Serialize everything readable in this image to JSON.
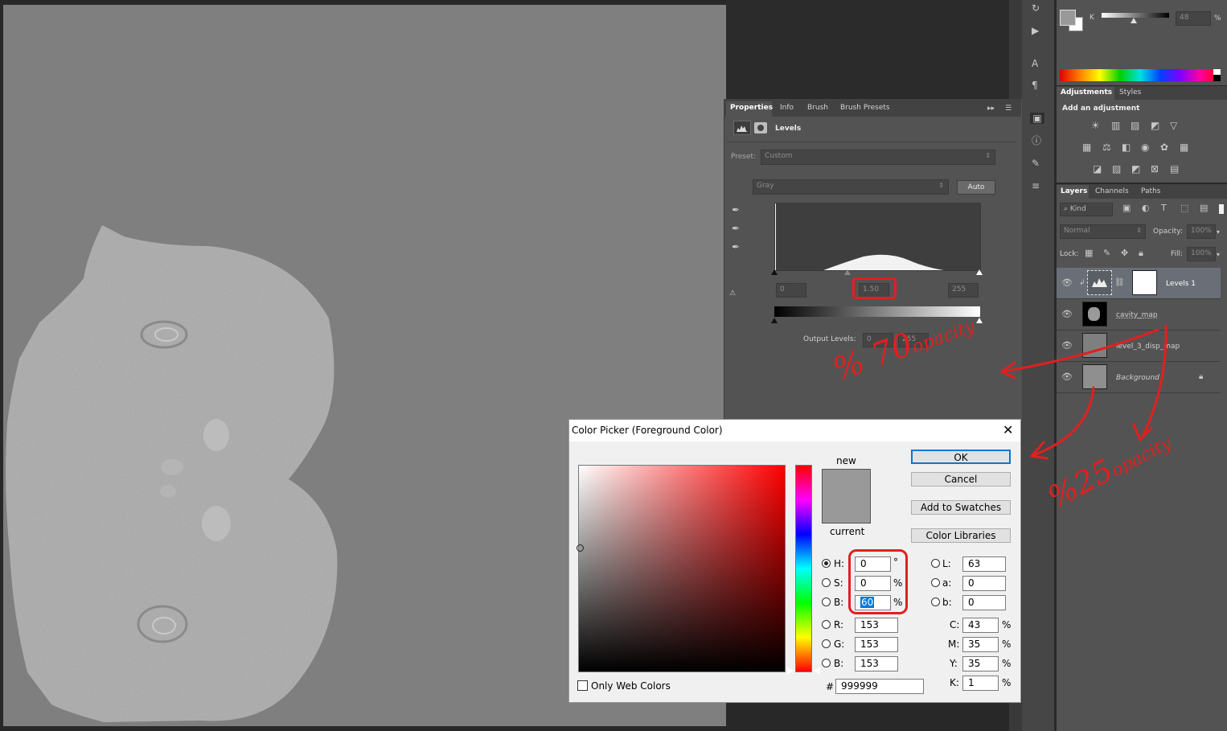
{
  "properties_panel": {
    "tabs": [
      "Properties",
      "Info",
      "Brush",
      "Brush Presets"
    ],
    "title": "Levels",
    "preset_label": "Preset:",
    "preset_value": "Custom",
    "channel_value": "Gray",
    "auto_label": "Auto",
    "input_black": "0",
    "input_gamma": "1.50",
    "input_white": "255",
    "output_label": "Output Levels:",
    "output_black": "0",
    "output_white": "255"
  },
  "color_panel": {
    "k_label": "K",
    "k_value": "48",
    "k_unit": "%"
  },
  "adjustments_panel": {
    "tabs": [
      "Adjustments",
      "Styles"
    ],
    "heading": "Add an adjustment"
  },
  "layers_panel": {
    "tabs": [
      "Layers",
      "Channels",
      "Paths"
    ],
    "filter_kind": "Kind",
    "blend_mode": "Normal",
    "opacity_label": "Opacity:",
    "opacity_value": "100%",
    "lock_label": "Lock:",
    "fill_label": "Fill:",
    "fill_value": "100%",
    "layers": [
      {
        "name": "Levels 1"
      },
      {
        "name": "cavity_map"
      },
      {
        "name": "level_3_disp_map"
      },
      {
        "name": "Background"
      }
    ]
  },
  "color_picker": {
    "title": "Color Picker (Foreground Color)",
    "new_label": "new",
    "current_label": "current",
    "ok_label": "OK",
    "cancel_label": "Cancel",
    "add_swatches_label": "Add to Swatches",
    "color_libraries_label": "Color Libraries",
    "h_label": "H:",
    "h_value": "0",
    "h_unit": "°",
    "s_label": "S:",
    "s_value": "0",
    "s_unit": "%",
    "b_label": "B:",
    "b_value": "60",
    "b_unit": "%",
    "r_label": "R:",
    "r_value": "153",
    "g_label": "G:",
    "g_value": "153",
    "bl_label": "B:",
    "bl_value": "153",
    "l_label": "L:",
    "l_value": "63",
    "a_label": "a:",
    "a_value": "0",
    "lb_label": "b:",
    "lb_value": "0",
    "c_label": "C:",
    "c_value": "43",
    "c_unit": "%",
    "m_label": "M:",
    "m_value": "35",
    "m_unit": "%",
    "y_label": "Y:",
    "y_value": "35",
    "y_unit": "%",
    "k_label": "K:",
    "k_value": "1",
    "k_unit": "%",
    "hash_label": "#",
    "hex_value": "999999",
    "web_colors_label": "Only Web Colors",
    "new_color": "#999999",
    "current_color": "#999999"
  },
  "annotations": {
    "note_70": "% 70",
    "note_70_small": "opacity",
    "note_25": "%25",
    "note_25_small": "opacity"
  },
  "colors": {
    "annotation_red": "#e0201f",
    "panel_bg": "#535353",
    "canvas_bg": "#7f7f7f",
    "selection_blue": "#0078d7"
  }
}
